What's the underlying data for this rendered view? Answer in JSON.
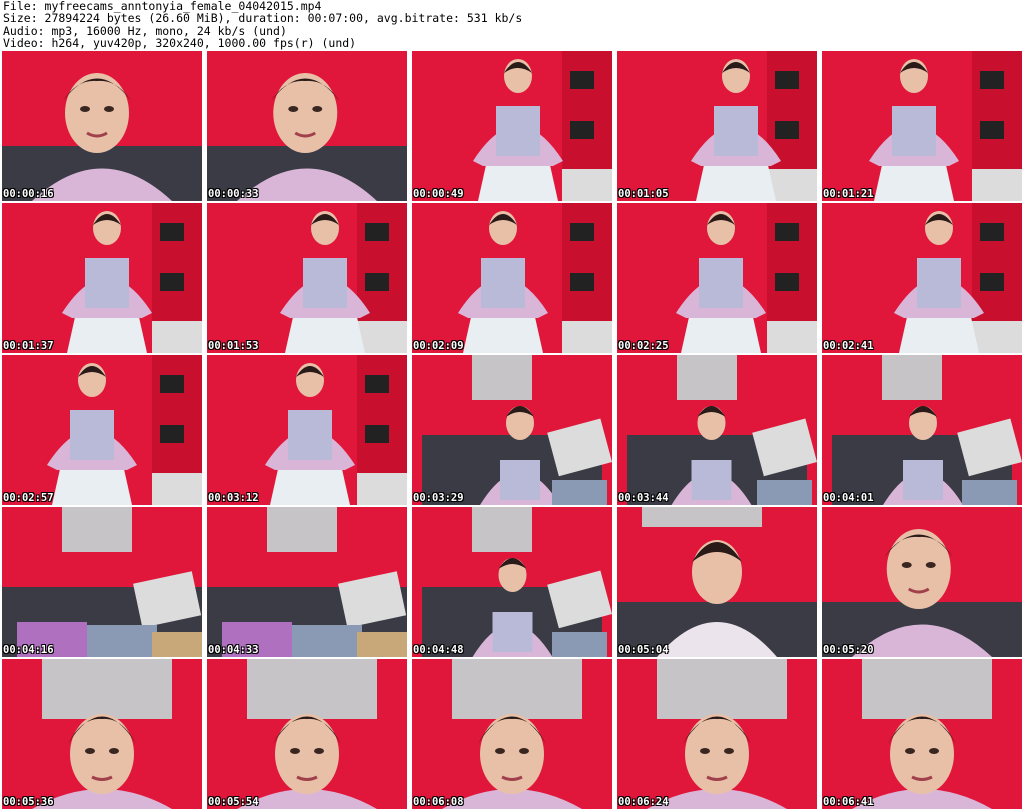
{
  "header": {
    "line1": "File: myfreecams_anntonyia_female_04042015.mp4",
    "line2": "Size: 27894224 bytes (26.60 MiB), duration: 00:07:00, avg.bitrate: 531 kb/s",
    "line3": "Audio: mp3, 16000 Hz, mono, 24 kb/s (und)",
    "line4": "Video: h264, yuv420p, 320x240, 1000.00 fps(r) (und)"
  },
  "thumbnails": [
    {
      "time": "00:00:16",
      "scene": "closeup"
    },
    {
      "time": "00:00:33",
      "scene": "closeup"
    },
    {
      "time": "00:00:49",
      "scene": "standing"
    },
    {
      "time": "00:01:05",
      "scene": "standing"
    },
    {
      "time": "00:01:21",
      "scene": "standing"
    },
    {
      "time": "00:01:37",
      "scene": "standing"
    },
    {
      "time": "00:01:53",
      "scene": "standing"
    },
    {
      "time": "00:02:09",
      "scene": "standing"
    },
    {
      "time": "00:02:25",
      "scene": "standing"
    },
    {
      "time": "00:02:41",
      "scene": "standing"
    },
    {
      "time": "00:02:57",
      "scene": "standing"
    },
    {
      "time": "00:03:12",
      "scene": "standing"
    },
    {
      "time": "00:03:29",
      "scene": "sofa-seated"
    },
    {
      "time": "00:03:44",
      "scene": "sofa-seated"
    },
    {
      "time": "00:04:01",
      "scene": "sofa-seated"
    },
    {
      "time": "00:04:16",
      "scene": "sofa-empty"
    },
    {
      "time": "00:04:33",
      "scene": "sofa-empty"
    },
    {
      "time": "00:04:48",
      "scene": "sofa-seated"
    },
    {
      "time": "00:05:04",
      "scene": "sofa-close"
    },
    {
      "time": "00:05:20",
      "scene": "closeup"
    },
    {
      "time": "00:05:36",
      "scene": "face-poster"
    },
    {
      "time": "00:05:54",
      "scene": "face-poster"
    },
    {
      "time": "00:06:08",
      "scene": "face-poster"
    },
    {
      "time": "00:06:24",
      "scene": "face-poster"
    },
    {
      "time": "00:06:41",
      "scene": "face-poster"
    }
  ],
  "colors": {
    "wall": "#e0173a",
    "shirt": "#d9b6d8",
    "skin": "#e8c0a8",
    "hair": "#2a1a18",
    "sofa": "#3a3b44",
    "skirt": "#e8eef2",
    "poster": "#c7c4c8",
    "pillow": "#dcdcdc"
  }
}
